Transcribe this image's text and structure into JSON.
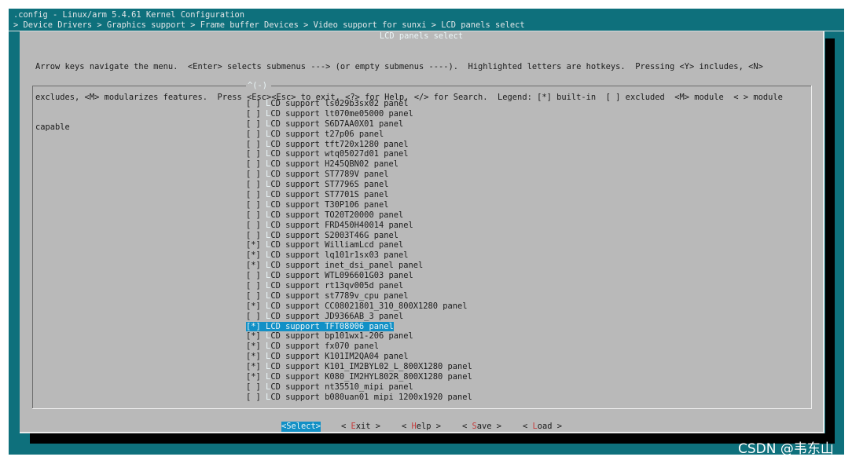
{
  "window": {
    "title": ".config - Linux/arm 5.4.61 Kernel Configuration",
    "breadcrumb": "> Device Drivers > Graphics support > Frame buffer Devices > Video support for sunxi > LCD panels select"
  },
  "dialog": {
    "title": "LCD panels select",
    "help_lines": [
      "Arrow keys navigate the menu.  <Enter> selects submenus ---> (or empty submenus ----).  Highlighted letters are hotkeys.  Pressing <Y> includes, <N>",
      "excludes, <M> modularizes features.  Press <Esc><Esc> to exit, <?> for Help, </> for Search.  Legend: [*] built-in  [ ] excluded  <M> module  < > module",
      "capable"
    ],
    "scroll_indicator": "^(-)"
  },
  "menu": {
    "hotkey": "L",
    "rest_prefix": "CD support ",
    "items": [
      {
        "mark": "[ ]",
        "name": "ls029b3sx02 panel"
      },
      {
        "mark": "[ ]",
        "name": "lt070me05000 panel"
      },
      {
        "mark": "[ ]",
        "name": "S6D7AA0X01 panel"
      },
      {
        "mark": "[ ]",
        "name": "t27p06 panel"
      },
      {
        "mark": "[ ]",
        "name": "tft720x1280 panel"
      },
      {
        "mark": "[ ]",
        "name": "wtq05027d01 panel"
      },
      {
        "mark": "[ ]",
        "name": "H245QBN02 panel"
      },
      {
        "mark": "[ ]",
        "name": "ST7789V panel"
      },
      {
        "mark": "[ ]",
        "name": "ST7796S panel"
      },
      {
        "mark": "[ ]",
        "name": "ST7701S panel"
      },
      {
        "mark": "[ ]",
        "name": "T30P106 panel"
      },
      {
        "mark": "[ ]",
        "name": "TO20T20000 panel"
      },
      {
        "mark": "[ ]",
        "name": "FRD450H40014 panel"
      },
      {
        "mark": "[ ]",
        "name": "S2003T46G panel"
      },
      {
        "mark": "[*]",
        "name": "WilliamLcd panel"
      },
      {
        "mark": "[*]",
        "name": "lq101r1sx03 panel"
      },
      {
        "mark": "[*]",
        "name": "inet_dsi_panel panel"
      },
      {
        "mark": "[ ]",
        "name": "WTL096601G03 panel"
      },
      {
        "mark": "[ ]",
        "name": "rt13qv005d panel"
      },
      {
        "mark": "[ ]",
        "name": "st7789v_cpu panel"
      },
      {
        "mark": "[*]",
        "name": "CC08021801_310_800X1280 panel"
      },
      {
        "mark": "[ ]",
        "name": "JD9366AB_3 panel"
      },
      {
        "mark": "[*]",
        "name": "TFT08006 panel",
        "selected": true
      },
      {
        "mark": "[*]",
        "name": "bp101wx1-206 panel"
      },
      {
        "mark": "[*]",
        "name": "fx070 panel"
      },
      {
        "mark": "[*]",
        "name": "K101IM2QA04 panel"
      },
      {
        "mark": "[*]",
        "name": "K101_IM2BYL02_L_800X1280 panel"
      },
      {
        "mark": "[*]",
        "name": "K080_IM2HYL802R_800X1280 panel"
      },
      {
        "mark": "[ ]",
        "name": "nt35510_mipi panel"
      },
      {
        "mark": "[ ]",
        "name": "b080uan01 mipi 1200x1920 panel"
      }
    ]
  },
  "buttons": [
    {
      "pre": "<",
      "hk": "S",
      "rest": "elect>",
      "active": true
    },
    {
      "pre": "< ",
      "hk": "E",
      "rest": "xit >",
      "active": false
    },
    {
      "pre": "< ",
      "hk": "H",
      "rest": "elp >",
      "active": false
    },
    {
      "pre": "< ",
      "hk": "S",
      "rest": "ave >",
      "active": false
    },
    {
      "pre": "< ",
      "hk": "L",
      "rest": "oad >",
      "active": false
    }
  ],
  "watermark": "CSDN @韦东山"
}
